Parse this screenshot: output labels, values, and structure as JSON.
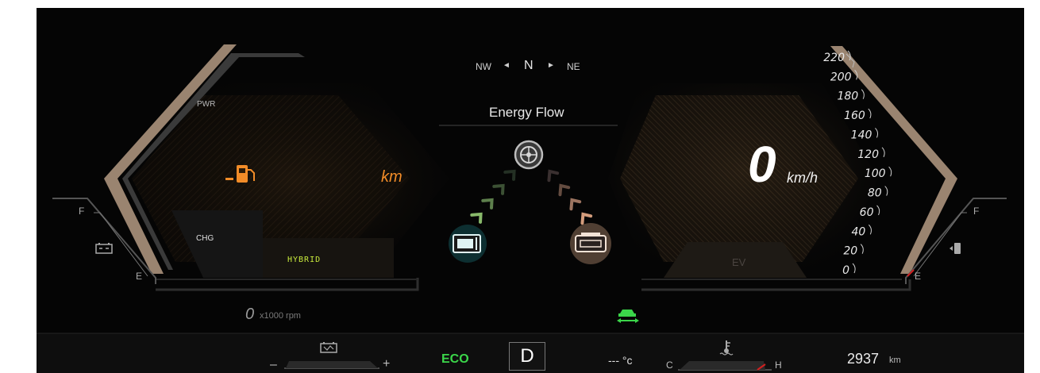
{
  "compass": {
    "left": "NW",
    "center": "N",
    "right": "NE"
  },
  "energy_flow": {
    "title": "Energy Flow"
  },
  "left_panel": {
    "pwr_label": "PWR",
    "chg_label": "CHG",
    "range_unit": "km",
    "drive_mode": "HYBRID",
    "fuel_gauge": {
      "full": "F",
      "empty": "E"
    }
  },
  "right_panel": {
    "speed_value": "0",
    "speed_unit": "km/h",
    "ev_label": "EV",
    "speed_ticks": [
      "220",
      "200",
      "180",
      "160",
      "140",
      "120",
      "100",
      "80",
      "60",
      "40",
      "20",
      "0"
    ],
    "fuel_gauge": {
      "full": "F",
      "empty": "E"
    }
  },
  "rpm": {
    "value": "0",
    "unit": "x1000 rpm"
  },
  "status_bar": {
    "battery_minus": "–",
    "battery_plus": "+",
    "eco": "ECO",
    "gear": "D",
    "temperature": "--- °c",
    "coolant_cold": "C",
    "coolant_hot": "H",
    "odometer": "2937",
    "odometer_unit": "km"
  },
  "colors": {
    "accent_orange": "#f28c28",
    "hybrid_green": "#c8ea3c",
    "eco_green": "#3bd64a",
    "bronze": "#a08a74"
  },
  "icons": [
    "fuel-pump-icon",
    "battery-icon",
    "wheel-icon",
    "engine-icon",
    "car-swap-icon",
    "coolant-temp-icon",
    "fuel-door-icon"
  ]
}
